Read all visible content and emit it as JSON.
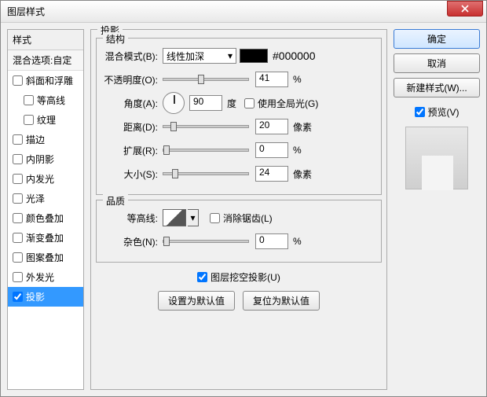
{
  "window": {
    "title": "图层样式"
  },
  "left": {
    "header": "样式",
    "sub": "混合选项:自定",
    "items": [
      {
        "label": "斜面和浮雕",
        "checked": false,
        "sub": false
      },
      {
        "label": "等高线",
        "checked": false,
        "sub": true
      },
      {
        "label": "纹理",
        "checked": false,
        "sub": true
      },
      {
        "label": "描边",
        "checked": false,
        "sub": false
      },
      {
        "label": "内阴影",
        "checked": false,
        "sub": false
      },
      {
        "label": "内发光",
        "checked": false,
        "sub": false
      },
      {
        "label": "光泽",
        "checked": false,
        "sub": false
      },
      {
        "label": "颜色叠加",
        "checked": false,
        "sub": false
      },
      {
        "label": "渐变叠加",
        "checked": false,
        "sub": false
      },
      {
        "label": "图案叠加",
        "checked": false,
        "sub": false
      },
      {
        "label": "外发光",
        "checked": false,
        "sub": false
      },
      {
        "label": "投影",
        "checked": true,
        "sub": false,
        "selected": true
      }
    ]
  },
  "mid": {
    "title": "投影",
    "structure": {
      "legend": "结构",
      "blend_label": "混合模式(B):",
      "blend_value": "线性加深",
      "swatch": "#000000",
      "hex": "#000000",
      "opacity_label": "不透明度(O):",
      "opacity_value": "41",
      "opacity_unit": "%",
      "angle_label": "角度(A):",
      "angle_value": "90",
      "angle_unit": "度",
      "global_label": "使用全局光(G)",
      "global_checked": false,
      "distance_label": "距离(D):",
      "distance_value": "20",
      "distance_unit": "像素",
      "spread_label": "扩展(R):",
      "spread_value": "0",
      "spread_unit": "%",
      "size_label": "大小(S):",
      "size_value": "24",
      "size_unit": "像素"
    },
    "quality": {
      "legend": "品质",
      "contour_label": "等高线:",
      "aa_label": "消除锯齿(L)",
      "aa_checked": false,
      "noise_label": "杂色(N):",
      "noise_value": "0",
      "noise_unit": "%"
    },
    "knockout_label": "图层挖空投影(U)",
    "knockout_checked": true,
    "btn_default": "设置为默认值",
    "btn_reset": "复位为默认值"
  },
  "right": {
    "ok": "确定",
    "cancel": "取消",
    "newstyle": "新建样式(W)...",
    "preview_label": "预览(V)",
    "preview_checked": true
  }
}
